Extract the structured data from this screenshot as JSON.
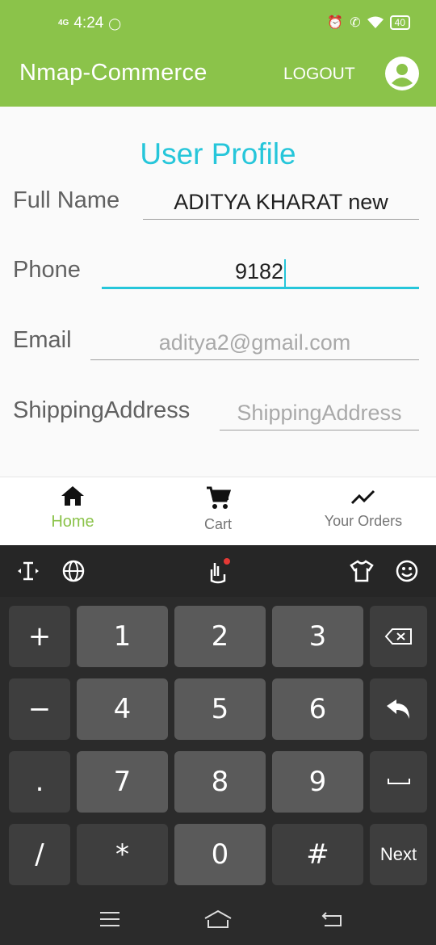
{
  "status_bar": {
    "time": "4:24",
    "network": "4G",
    "battery": "40"
  },
  "app_bar": {
    "title": "Nmap-Commerce",
    "logout_label": "LOGOUT"
  },
  "profile": {
    "title": "User Profile",
    "fields": [
      {
        "label": "Full Name",
        "value": "ADITYA KHARAT new",
        "placeholder": ""
      },
      {
        "label": "Phone",
        "value": "9182",
        "placeholder": ""
      },
      {
        "label": "Email",
        "value": "",
        "placeholder": "aditya2@gmail.com"
      },
      {
        "label": "ShippingAddress",
        "value": "",
        "placeholder": "ShippingAddress"
      }
    ]
  },
  "bottom_nav": {
    "items": [
      {
        "label": "Home",
        "icon": "home-icon",
        "active": true
      },
      {
        "label": "Cart",
        "icon": "cart-icon",
        "active": false
      },
      {
        "label": "Your Orders",
        "icon": "trending-up-icon",
        "active": false
      }
    ]
  },
  "keyboard": {
    "toolbar_icons": [
      "text-cursor-icon",
      "globe-icon",
      "gesture-icon",
      "theme-shirt-icon",
      "emoji-icon"
    ],
    "rows": [
      [
        "+",
        "1",
        "2",
        "3",
        "⌫"
      ],
      [
        "−",
        "4",
        "5",
        "6",
        "↩"
      ],
      [
        ".",
        "7",
        "8",
        "9",
        "␣"
      ],
      [
        "/",
        "*",
        "0",
        "#",
        "Next"
      ]
    ]
  },
  "colors": {
    "accent_green": "#8bc34a",
    "accent_teal": "#26c6da"
  }
}
